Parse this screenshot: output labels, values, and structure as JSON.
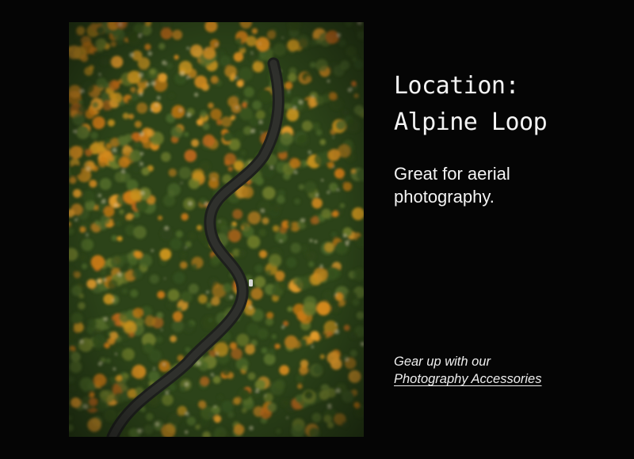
{
  "location": {
    "title_line1": "Location:",
    "title_line2": "Alpine Loop"
  },
  "tagline": "Great for aerial photography.",
  "promo": {
    "prefix": "Gear up with our",
    "link_label": "Photography Accessories"
  },
  "photo": {
    "subject": "aerial-forest-road-photo"
  },
  "colors": {
    "background": "#050505",
    "text": "#f4f4f4",
    "foliage_orange": "#d88a1c",
    "foliage_green": "#3f5a24",
    "road": "#2a2a2a"
  }
}
